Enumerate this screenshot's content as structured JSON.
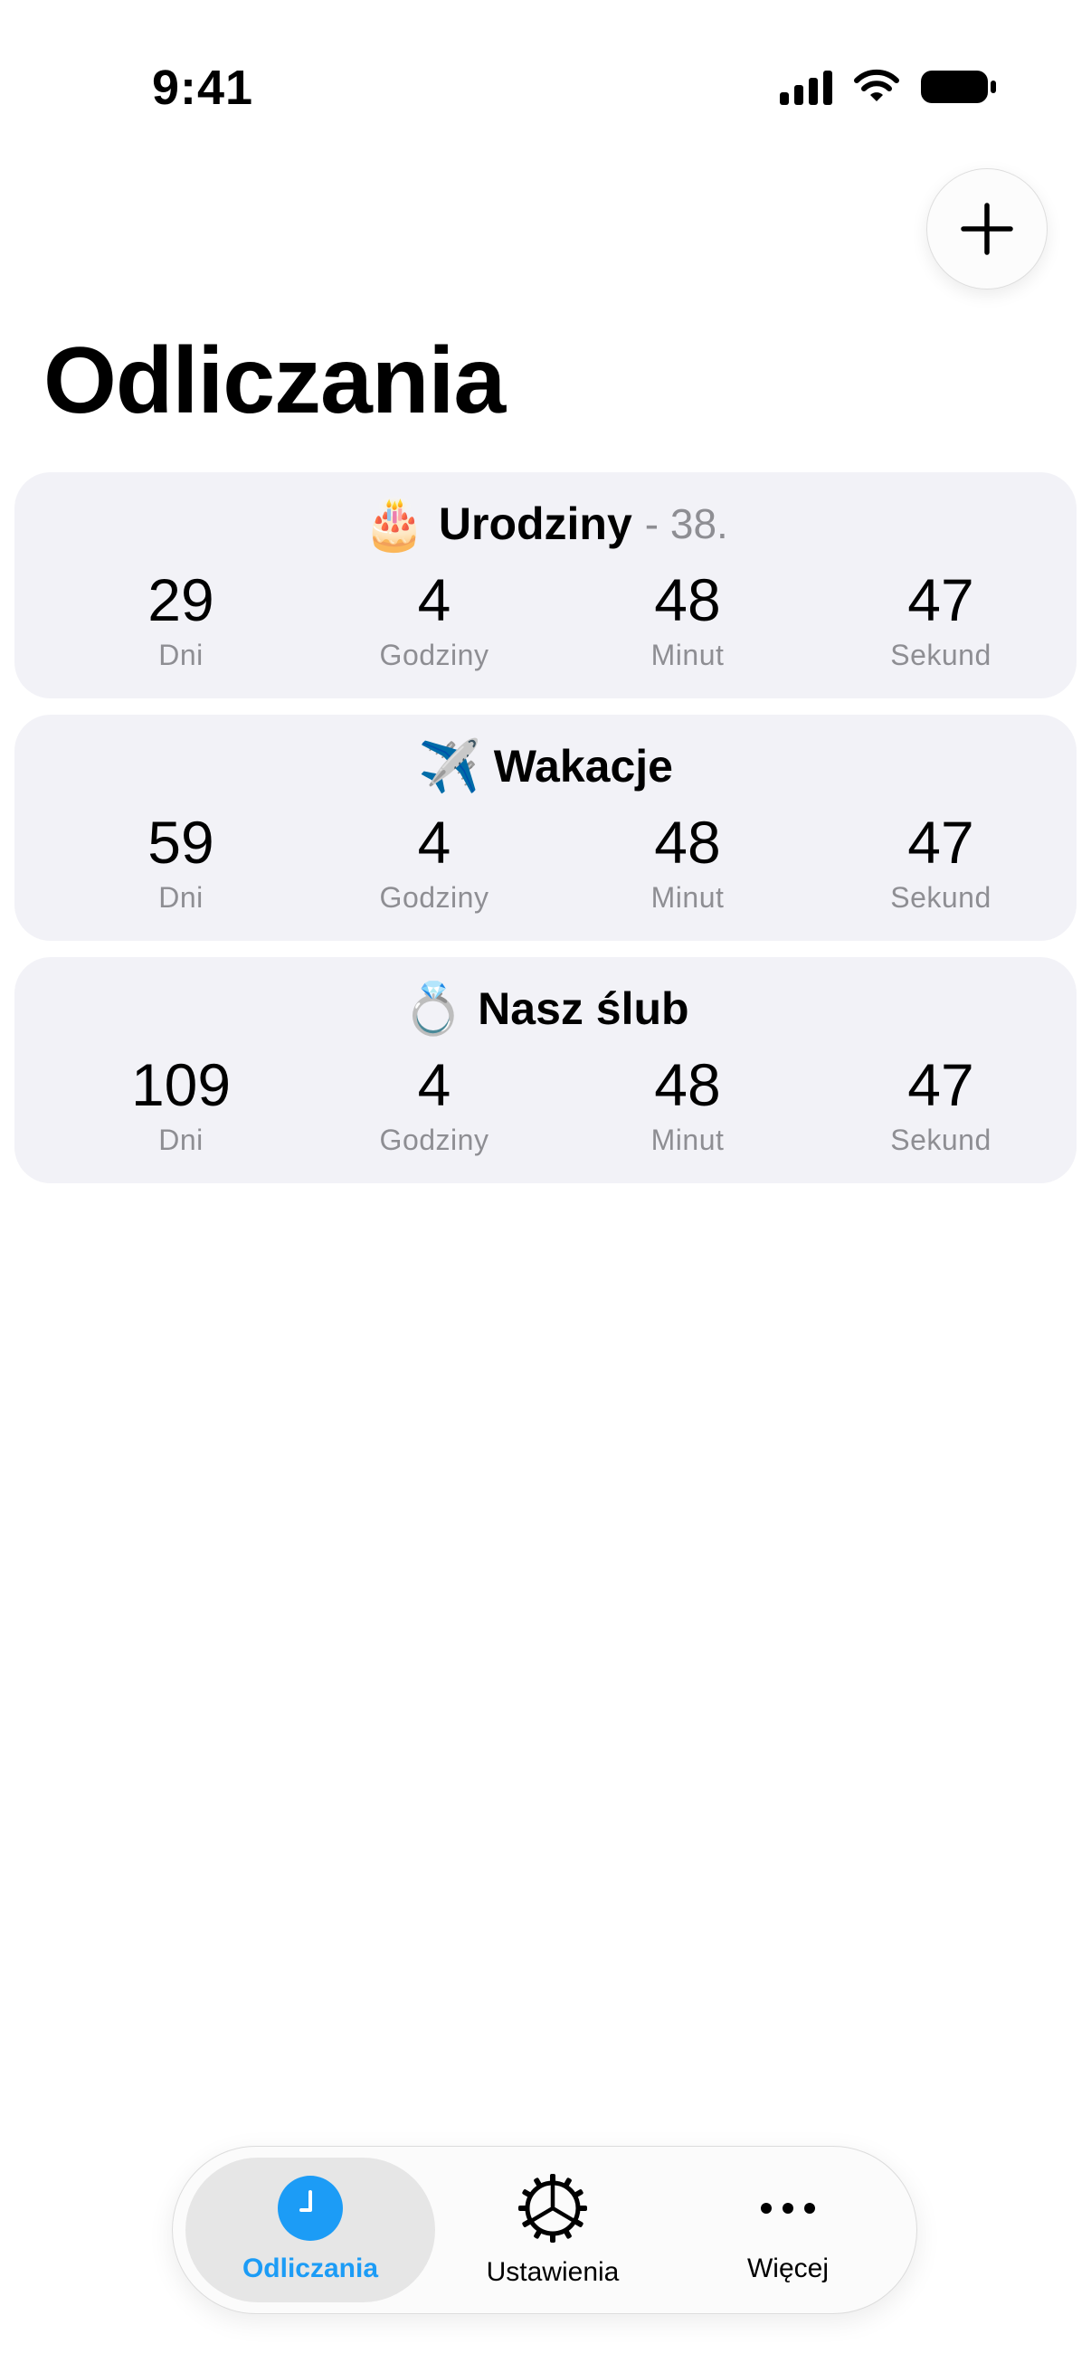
{
  "status_bar": {
    "time": "9:41"
  },
  "header": {
    "title": "Odliczania"
  },
  "countdowns": [
    {
      "emoji": "🎂",
      "name": "Urodziny",
      "suffix": "- 38.",
      "values": [
        "29",
        "4",
        "48",
        "47"
      ]
    },
    {
      "emoji": "✈️",
      "name": "Wakacje",
      "suffix": "",
      "values": [
        "59",
        "4",
        "48",
        "47"
      ]
    },
    {
      "emoji": "💍",
      "name": "Nasz ślub",
      "suffix": "",
      "values": [
        "109",
        "4",
        "48",
        "47"
      ]
    }
  ],
  "unit_labels": [
    "Dni",
    "Godziny",
    "Minut",
    "Sekund"
  ],
  "tabs": [
    {
      "label": "Odliczania",
      "icon": "clock-icon",
      "active": true
    },
    {
      "label": "Ustawienia",
      "icon": "gear-icon",
      "active": false
    },
    {
      "label": "Więcej",
      "icon": "ellipsis-icon",
      "active": false
    }
  ],
  "colors": {
    "accent": "#1c9cf6",
    "card_bg": "#f2f2f7",
    "secondary_text": "#8e8e93"
  }
}
